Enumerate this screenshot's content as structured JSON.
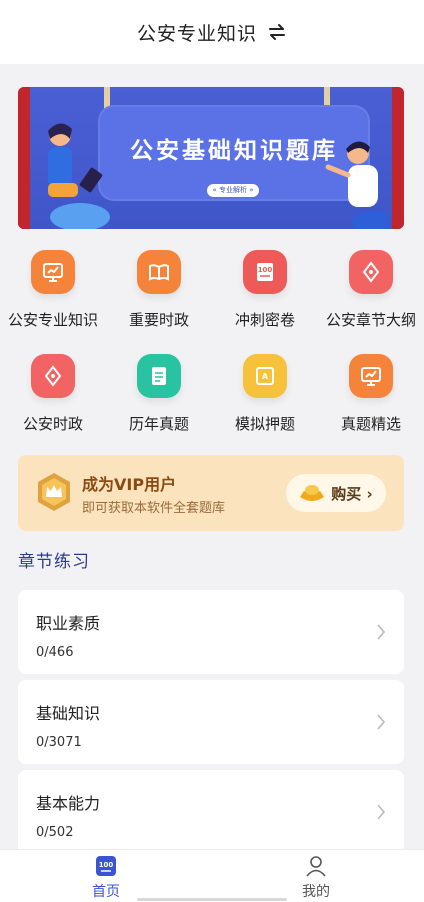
{
  "header": {
    "title": "公安专业知识",
    "swap_icon": "swap-arrows-icon"
  },
  "banner": {
    "title": "公安基础知识题库",
    "tag": "« 专业解析 »"
  },
  "grid": [
    {
      "label": "公安专业知识",
      "icon": "chart-board-icon",
      "color": "#f5843a"
    },
    {
      "label": "重要时政",
      "icon": "book-icon",
      "color": "#f5843a"
    },
    {
      "label": "冲刺密卷",
      "icon": "score-100-icon",
      "color": "#ee5a57"
    },
    {
      "label": "公安章节大纲",
      "icon": "pen-tip-icon",
      "color": "#f26464"
    },
    {
      "label": "公安时政",
      "icon": "pen-tip-icon",
      "color": "#f26464"
    },
    {
      "label": "历年真题",
      "icon": "document-icon",
      "color": "#29c3a2"
    },
    {
      "label": "模拟押题",
      "icon": "certificate-icon",
      "color": "#f7c23b"
    },
    {
      "label": "真题精选",
      "icon": "chart-board-icon",
      "color": "#f5843a"
    }
  ],
  "vip": {
    "title": "成为VIP用户",
    "subtitle": "即可获取本软件全套题库",
    "buy_label": "购买 ›"
  },
  "section": {
    "title": "章节练习"
  },
  "chapters": [
    {
      "title": "职业素质",
      "count": "0/466"
    },
    {
      "title": "基础知识",
      "count": "0/3071"
    },
    {
      "title": "基本能力",
      "count": "0/502"
    }
  ],
  "nav": {
    "home_label": "首页",
    "mine_label": "我的",
    "active_color": "#3b53d6"
  }
}
